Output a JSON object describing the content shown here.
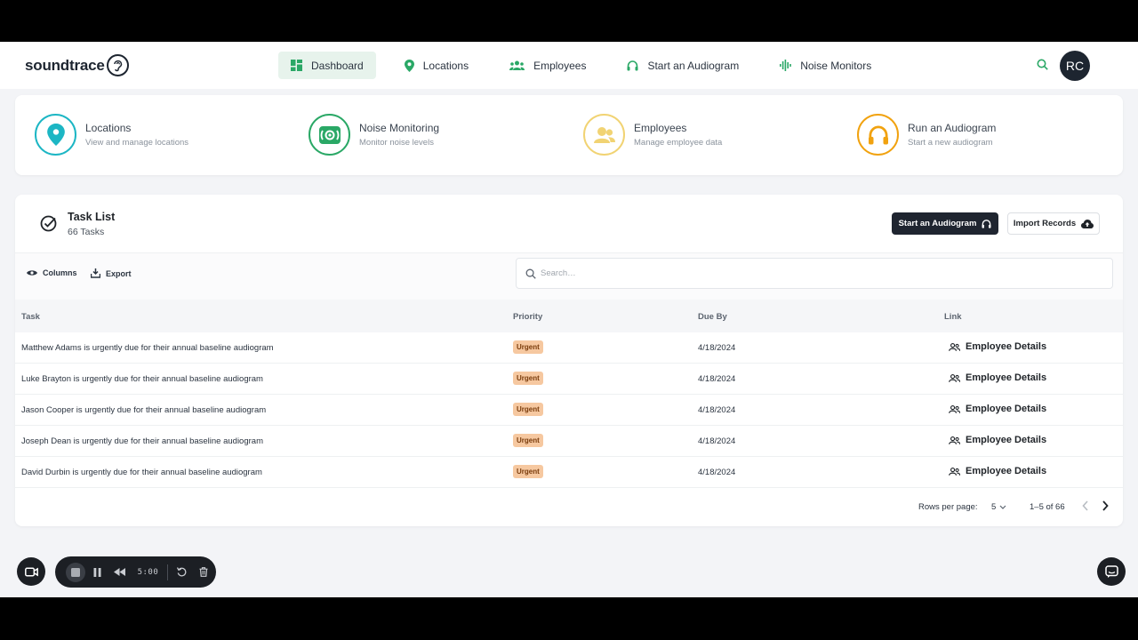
{
  "header": {
    "logo_text": "soundtrace",
    "nav": [
      {
        "label": "Dashboard",
        "icon": "dashboard-icon",
        "active": true
      },
      {
        "label": "Locations",
        "icon": "location-pin-icon"
      },
      {
        "label": "Employees",
        "icon": "group-icon"
      },
      {
        "label": "Start an Audiogram",
        "icon": "headphones-icon"
      },
      {
        "label": "Noise Monitors",
        "icon": "sound-wave-icon"
      }
    ],
    "avatar_initials": "RC",
    "accent_color": "#2aa866"
  },
  "quick_links": [
    {
      "title": "Locations",
      "subtitle": "View and manage locations",
      "icon": "location-pin-icon",
      "color": "#1cb6c4"
    },
    {
      "title": "Noise Monitoring",
      "subtitle": "Monitor noise levels",
      "icon": "noise-monitor-icon",
      "color": "#2aa866"
    },
    {
      "title": "Employees",
      "subtitle": "Manage employee data",
      "icon": "group-icon",
      "color": "#f1d373"
    },
    {
      "title": "Run an Audiogram",
      "subtitle": "Start a new audiogram",
      "icon": "headphones-icon",
      "color": "#f1a20f"
    }
  ],
  "tasks": {
    "title": "Task List",
    "count_label": "66 Tasks",
    "start_button": "Start an Audiogram",
    "import_button": "Import Records",
    "columns_label": "Columns",
    "export_label": "Export",
    "search_placeholder": "Search…",
    "headers": {
      "task": "Task",
      "priority": "Priority",
      "due": "Due By",
      "link": "Link"
    },
    "rows": [
      {
        "task": "Matthew Adams is urgently due for their annual baseline audiogram",
        "priority": "Urgent",
        "due": "4/18/2024",
        "link": "Employee Details"
      },
      {
        "task": "Luke Brayton is urgently due for their annual baseline audiogram",
        "priority": "Urgent",
        "due": "4/18/2024",
        "link": "Employee Details"
      },
      {
        "task": "Jason Cooper is urgently due for their annual baseline audiogram",
        "priority": "Urgent",
        "due": "4/18/2024",
        "link": "Employee Details"
      },
      {
        "task": "Joseph Dean is urgently due for their annual baseline audiogram",
        "priority": "Urgent",
        "due": "4/18/2024",
        "link": "Employee Details"
      },
      {
        "task": "David Durbin is urgently due for their annual baseline audiogram",
        "priority": "Urgent",
        "due": "4/18/2024",
        "link": "Employee Details"
      }
    ],
    "footer": {
      "rows_per_page_label": "Rows per page:",
      "rows_per_page": "5",
      "range": "1–5 of 66"
    }
  },
  "recorder": {
    "time": "5:00"
  }
}
